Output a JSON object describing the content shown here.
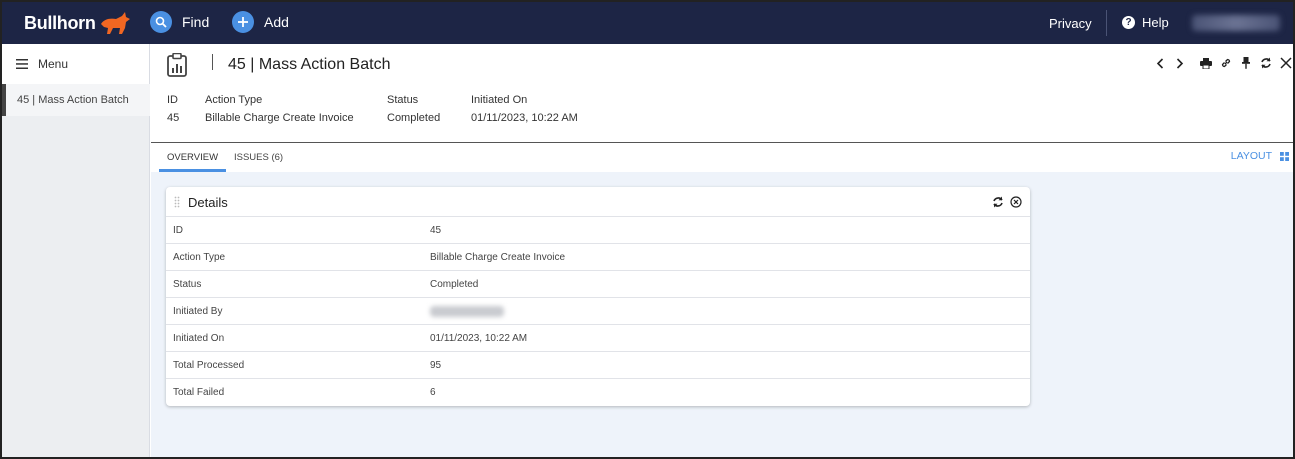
{
  "topbar": {
    "logo_text": "Bullhorn",
    "find_label": "Find",
    "add_label": "Add",
    "privacy_label": "Privacy",
    "help_label": "Help"
  },
  "sidebar": {
    "menu_label": "Menu",
    "items": [
      {
        "label": "45 | Mass Action Batch"
      }
    ]
  },
  "record": {
    "title": "45 | Mass Action Batch",
    "meta": [
      {
        "label": "ID",
        "value": "45"
      },
      {
        "label": "Action Type",
        "value": "Billable Charge Create Invoice"
      },
      {
        "label": "Status",
        "value": "Completed"
      },
      {
        "label": "Initiated On",
        "value": "01/11/2023, 10:22 AM"
      }
    ]
  },
  "tabs": [
    {
      "label": "OVERVIEW",
      "active": true
    },
    {
      "label": "ISSUES (6)",
      "active": false
    }
  ],
  "layout_label": "LAYOUT",
  "details": {
    "title": "Details",
    "rows": [
      {
        "key": "ID",
        "value": "45"
      },
      {
        "key": "Action Type",
        "value": "Billable Charge Create Invoice"
      },
      {
        "key": "Status",
        "value": "Completed"
      },
      {
        "key": "Initiated By",
        "value": ""
      },
      {
        "key": "Initiated On",
        "value": "01/11/2023, 10:22 AM"
      },
      {
        "key": "Total Processed",
        "value": "95"
      },
      {
        "key": "Total Failed",
        "value": "6"
      }
    ]
  },
  "colors": {
    "topbar_bg": "#1d2545",
    "accent": "#4a90e2",
    "logo_bull": "#f26722"
  },
  "icons": [
    "search-icon",
    "plus-icon",
    "help-icon",
    "menu-icon",
    "report-icon",
    "chevron-left-icon",
    "chevron-right-icon",
    "print-icon",
    "link-icon",
    "pin-icon",
    "refresh-icon",
    "close-icon",
    "grid-icon",
    "drag-handle-icon",
    "close-circle-icon"
  ]
}
